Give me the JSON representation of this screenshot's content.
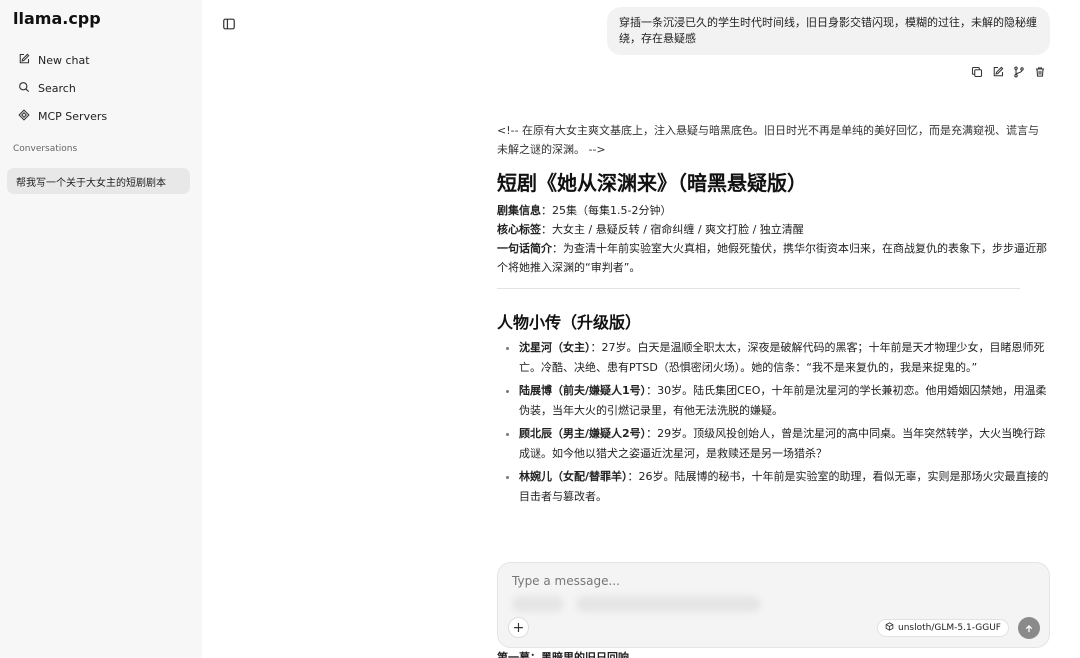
{
  "app": {
    "title": "llama.cpp"
  },
  "sidebar": {
    "nav": [
      {
        "label": "New chat",
        "icon": "edit-icon"
      },
      {
        "label": "Search",
        "icon": "search-icon"
      },
      {
        "label": "MCP Servers",
        "icon": "mcp-icon"
      }
    ],
    "section_label": "Conversations",
    "conversations": [
      {
        "title": "帮我写一个关于大女主的短剧剧本"
      }
    ]
  },
  "user_message": {
    "text": "穿插一条沉浸已久的学生时代时间线，旧日身影交错闪现，模糊的过往，未解的隐秘缠绕，存在悬疑感"
  },
  "assistant_message": {
    "comment": "<!-- 在原有大女主爽文基底上，注入悬疑与暗黑底色。旧日时光不再是单纯的美好回忆，而是充满窥视、谎言与未解之谜的深渊。 -->",
    "title": "短剧《她从深渊来》（暗黑悬疑版）",
    "meta": [
      {
        "label": "剧集信息",
        "value": "：25集（每集1.5-2分钟）"
      },
      {
        "label": "核心标签",
        "value": "：大女主 / 悬疑反转 / 宿命纠缠 / 爽文打脸 / 独立清醒"
      },
      {
        "label": "一句话简介",
        "value": "：为查清十年前实验室大火真相，她假死蛰伏，携华尔街资本归来，在商战复仇的表象下，步步逼近那个将她推入深渊的“审判者”。"
      }
    ],
    "section_title": "人物小传（升级版）",
    "characters": [
      {
        "name": "沈星河（女主）",
        "desc": "：27岁。白天是温顺全职太太，深夜是破解代码的黑客；十年前是天才物理少女，目睹恩师死亡。冷酷、决绝、患有PTSD（恐惧密闭火场）。她的信条：“我不是来复仇的，我是来捉鬼的。”"
      },
      {
        "name": "陆展博（前夫/嫌疑人1号）",
        "desc": "：30岁。陆氏集团CEO，十年前是沈星河的学长兼初恋。他用婚姻囚禁她，用温柔伪装，当年大火的引燃记录里，有他无法洗脱的嫌疑。"
      },
      {
        "name": "顾北辰（男主/嫌疑人2号）",
        "desc": "：29岁。顶级风投创始人，曾是沈星河的高中同桌。当年突然转学，大火当晚行踪成谜。如今他以猎犬之姿逼近沈星河，是救赎还是另一场猎杀？"
      },
      {
        "name": "林婉儿（女配/替罪羊）",
        "desc": "：26岁。陆展博的秘书，十年前是实验室的助理，看似无辜，实则是那场火灾最直接的目击者与篡改者。"
      }
    ],
    "below_composer_text": "第一幕：黑暗里的旧日回响"
  },
  "composer": {
    "placeholder": "Type a message...",
    "attach_label": "+",
    "model": "unsloth/GLM-5.1-GGUF"
  }
}
